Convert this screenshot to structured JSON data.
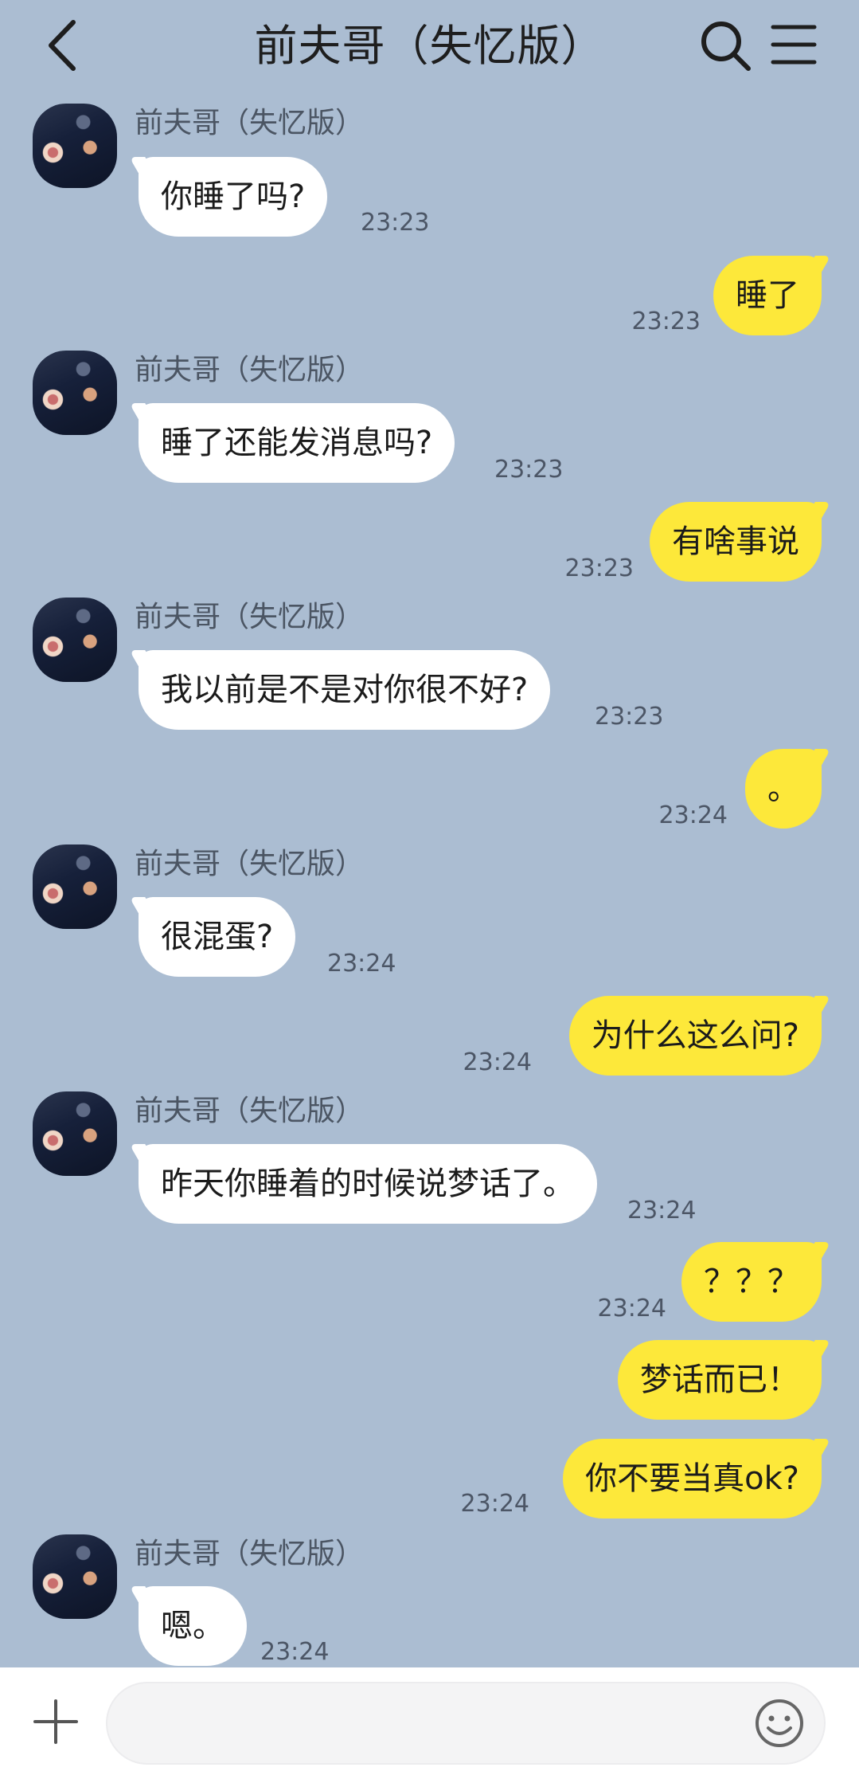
{
  "header": {
    "title": "前夫哥（失忆版）",
    "back_icon": "chevron-left-icon",
    "search_icon": "search-icon",
    "menu_icon": "hamburger-menu-icon"
  },
  "contact": {
    "name": "前夫哥（失忆版）"
  },
  "messages": [
    {
      "side": "in",
      "text": "你睡了吗?",
      "time": "23:23"
    },
    {
      "side": "out",
      "text": "睡了",
      "time": "23:23"
    },
    {
      "side": "in",
      "text": "睡了还能发消息吗?",
      "time": "23:23"
    },
    {
      "side": "out",
      "text": "有啥事说",
      "time": "23:23"
    },
    {
      "side": "in",
      "text": "我以前是不是对你很不好?",
      "time": "23:23"
    },
    {
      "side": "out",
      "text": "。",
      "time": "23:24"
    },
    {
      "side": "in",
      "text": "很混蛋?",
      "time": "23:24"
    },
    {
      "side": "out",
      "text": "为什么这么问?",
      "time": "23:24"
    },
    {
      "side": "in",
      "text": "昨天你睡着的时候说梦话了。",
      "time": "23:24"
    },
    {
      "side": "out",
      "text": "？？？",
      "time": "23:24"
    },
    {
      "side": "out",
      "text": "梦话而已！",
      "time": ""
    },
    {
      "side": "out",
      "text": "你不要当真ok?",
      "time": "23:24"
    },
    {
      "side": "in",
      "text": "嗯。",
      "time": "23:24"
    }
  ],
  "input_bar": {
    "plus_icon": "plus-icon",
    "input_value": "",
    "emoji_icon": "emoji-smile-icon"
  },
  "colors": {
    "background": "#abbdd2",
    "outgoing_bubble": "#fde83a",
    "incoming_bubble": "#ffffff"
  }
}
